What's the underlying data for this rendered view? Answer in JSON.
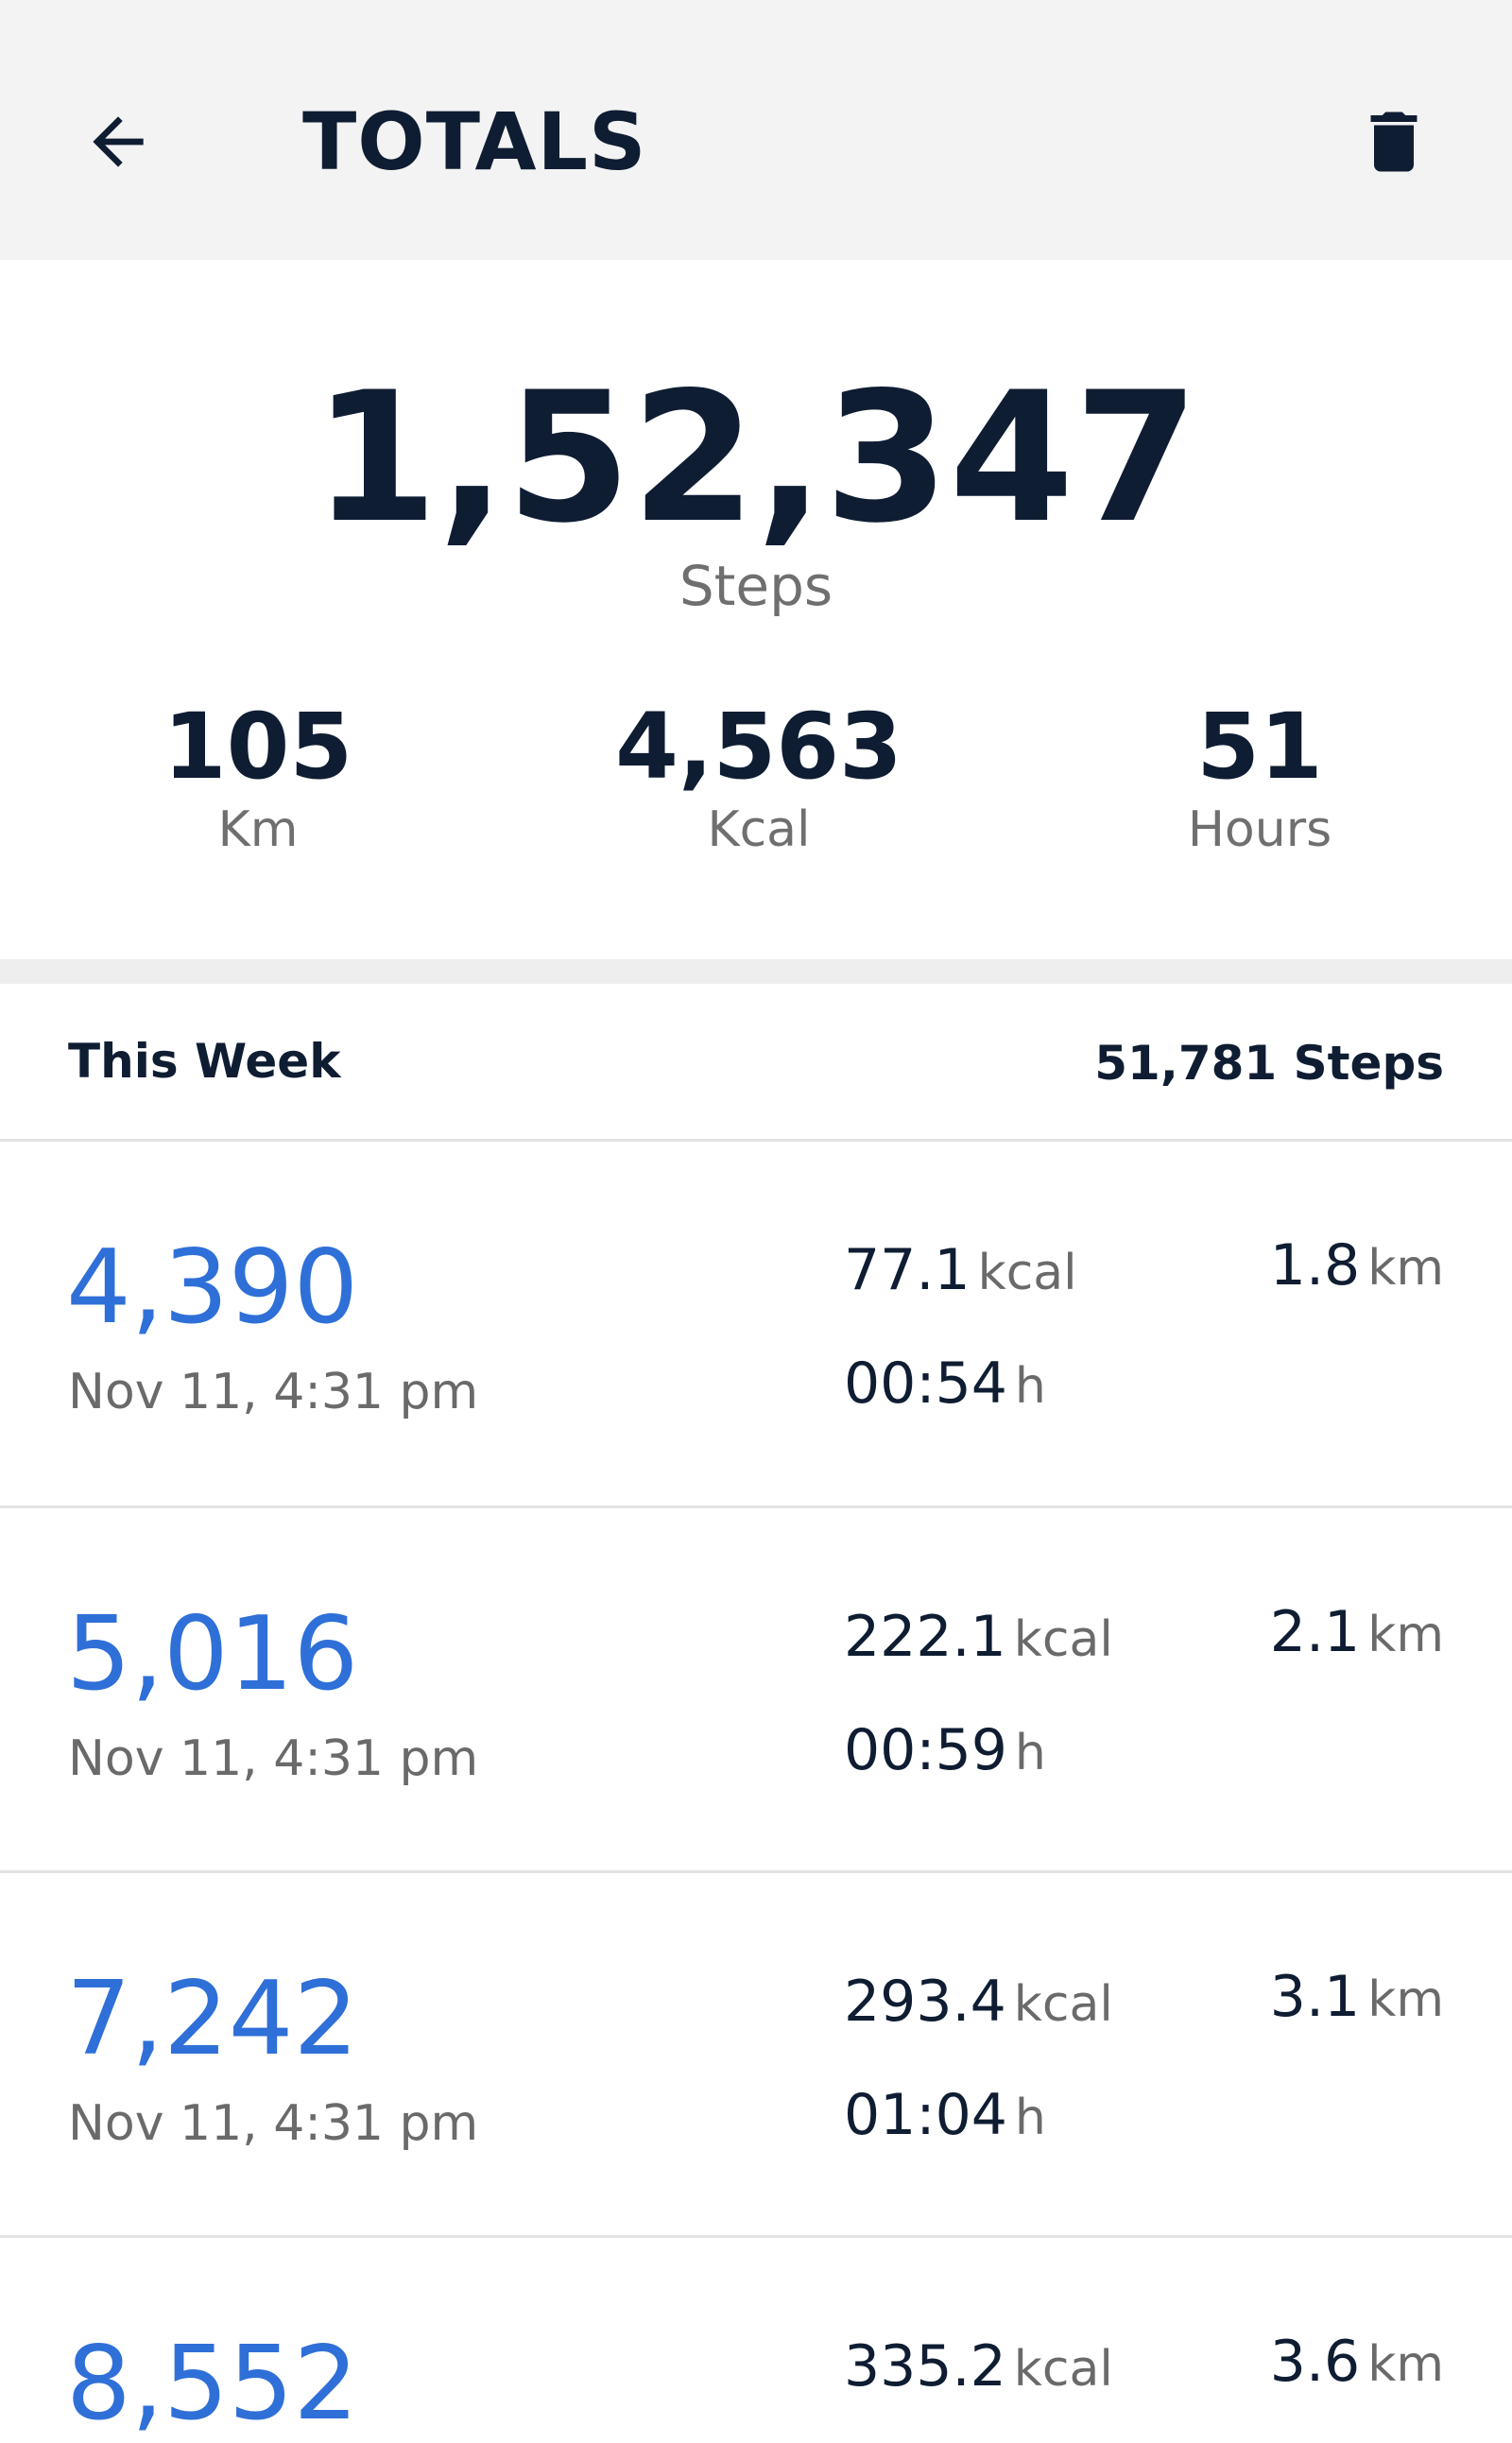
{
  "header": {
    "title": "TOTALS",
    "back_icon": "arrow-left-icon",
    "delete_icon": "trash-icon"
  },
  "summary": {
    "steps": "1,52,347",
    "steps_label": "Steps",
    "stats": [
      {
        "value": "105",
        "unit": "Km"
      },
      {
        "value": "4,563",
        "unit": "Kcal"
      },
      {
        "value": "51",
        "unit": "Hours"
      }
    ]
  },
  "week": {
    "label": "This Week",
    "total": "51,781 Steps"
  },
  "entries": [
    {
      "steps": "4,390",
      "date": "Nov 11, 4:31 pm",
      "kcal": "77.1",
      "kcal_unit": "kcal",
      "time": "00:54",
      "time_unit": "h",
      "km": "1.8",
      "km_unit": "km"
    },
    {
      "steps": "5,016",
      "date": "Nov 11, 4:31 pm",
      "kcal": "222.1",
      "kcal_unit": "kcal",
      "time": "00:59",
      "time_unit": "h",
      "km": "2.1",
      "km_unit": "km"
    },
    {
      "steps": "7,242",
      "date": "Nov 11, 4:31 pm",
      "kcal": "293.4",
      "kcal_unit": "kcal",
      "time": "01:04",
      "time_unit": "h",
      "km": "3.1",
      "km_unit": "km"
    },
    {
      "steps": "8,552",
      "date": "",
      "kcal": "335.2",
      "kcal_unit": "kcal",
      "time": "",
      "time_unit": "",
      "km": "3.6",
      "km_unit": "km"
    }
  ],
  "colors": {
    "primary_text": "#0f1d33",
    "accent_blue": "#2f6fd8",
    "secondary_text": "#6f6f6f",
    "app_bar_bg": "#f3f3f3"
  }
}
